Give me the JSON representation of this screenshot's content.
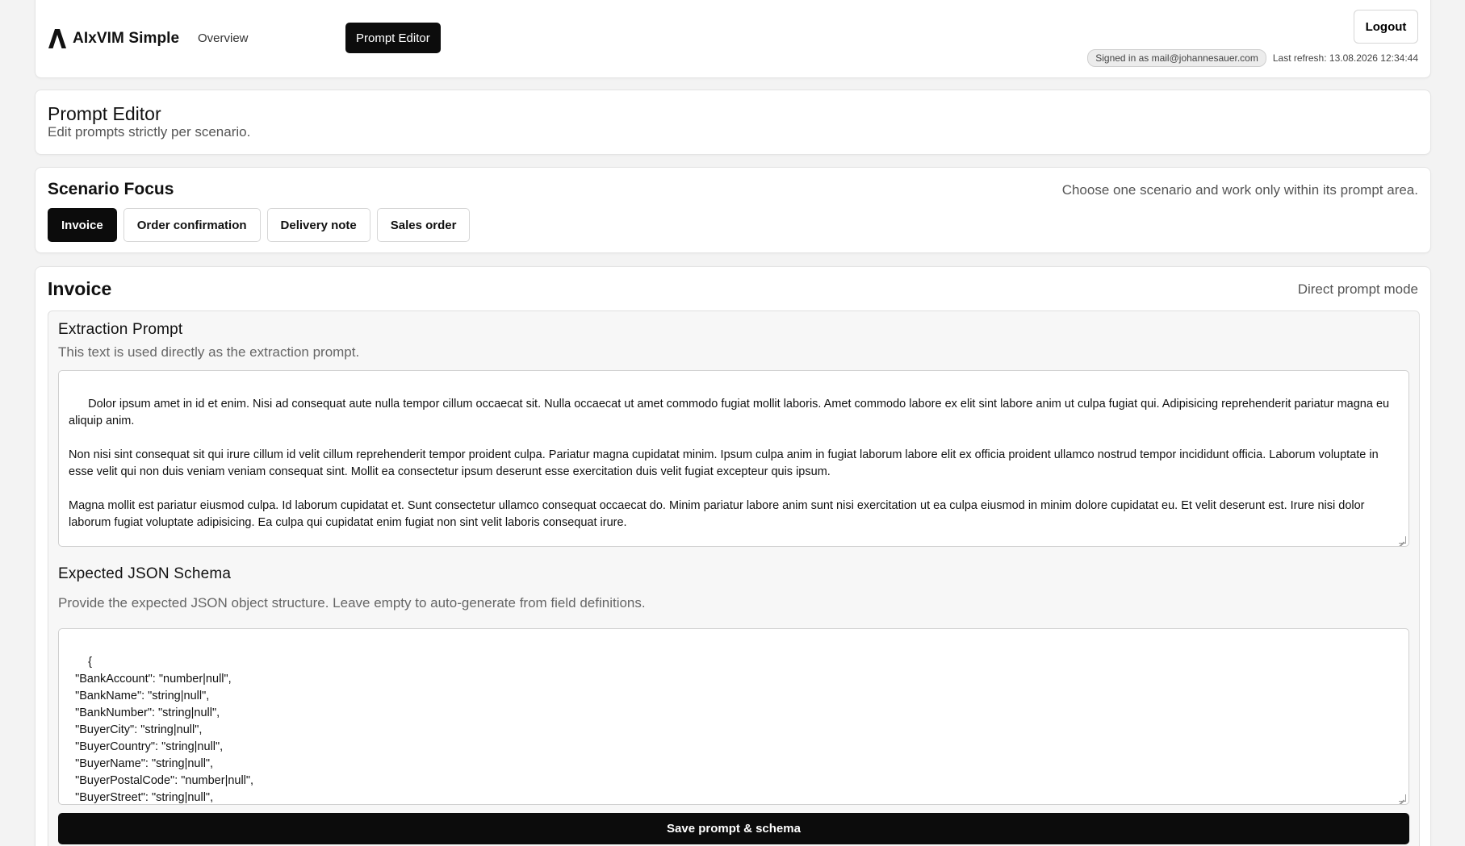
{
  "app": {
    "name": "AIxVIM Simple",
    "icon": "logo-a-icon"
  },
  "nav": {
    "overview_label": "Overview",
    "prompt_editor_label": "Prompt Editor"
  },
  "header": {
    "logout_label": "Logout",
    "signed_in": "Signed in as mail@johannesauer.com",
    "last_refresh": "Last refresh: 13.08.2026 12:34:44"
  },
  "page": {
    "title": "Prompt Editor",
    "subtitle": "Edit prompts strictly per scenario."
  },
  "scenario": {
    "title": "Scenario Focus",
    "hint": "Choose one scenario and work only within its prompt area.",
    "tabs": [
      {
        "label": "Invoice",
        "active": true
      },
      {
        "label": "Order confirmation",
        "active": false
      },
      {
        "label": "Delivery note",
        "active": false
      },
      {
        "label": "Sales order",
        "active": false
      }
    ]
  },
  "editor": {
    "title": "Invoice",
    "mode": "Direct prompt mode",
    "extraction": {
      "heading": "Extraction Prompt",
      "description": "This text is used directly as the extraction prompt.",
      "value": "Dolor ipsum amet in id et enim. Nisi ad consequat aute nulla tempor cillum occaecat sit. Nulla occaecat ut amet commodo fugiat mollit laboris. Amet commodo labore ex elit sint labore anim ut culpa fugiat qui. Adipisicing reprehenderit pariatur magna eu aliquip anim.\n\nNon nisi sint consequat sit qui irure cillum id velit cillum reprehenderit tempor proident culpa. Pariatur magna cupidatat minim. Ipsum culpa anim in fugiat laborum labore elit ex officia proident ullamco nostrud tempor incididunt officia. Laborum voluptate in esse velit qui non duis veniam veniam consequat sint. Mollit ea consectetur ipsum deserunt esse exercitation duis velit fugiat excepteur quis ipsum.\n\nMagna mollit est pariatur eiusmod culpa. Id laborum cupidatat et. Sunt consectetur ullamco consequat occaecat do. Minim pariatur labore anim sunt nisi exercitation ut ea culpa eiusmod in minim dolore cupidatat eu. Et velit deserunt est. Irure nisi dolor laborum fugiat voluptate adipisicing. Ea culpa qui cupidatat enim fugiat non sint velit laboris consequat irure.\n\nIrure id sit qui do amet eiusmod. Fugiat in reprehenderit sunt reprehenderit cillum ea ad sunt voluptate culpa voluptate. Nostrud in aute non est consequat officia eiusmod aute aliquip Lorem est nostrud incididunt mollit. Qui voluptate occaecat veniam qui"
    },
    "schema": {
      "heading": "Expected JSON Schema",
      "description": "Provide the expected JSON object structure. Leave empty to auto-generate from field definitions.",
      "value": "{\n  \"BankAccount\": \"number|null\",\n  \"BankName\": \"string|null\",\n  \"BankNumber\": \"string|null\",\n  \"BuyerCity\": \"string|null\",\n  \"BuyerCountry\": \"string|null\",\n  \"BuyerName\": \"string|null\",\n  \"BuyerPostalCode\": \"number|null\",\n  \"BuyerStreet\": \"string|null\",\n  \"BuyerVAT\": \"string|null\","
    },
    "save_label": "Save prompt & schema"
  }
}
